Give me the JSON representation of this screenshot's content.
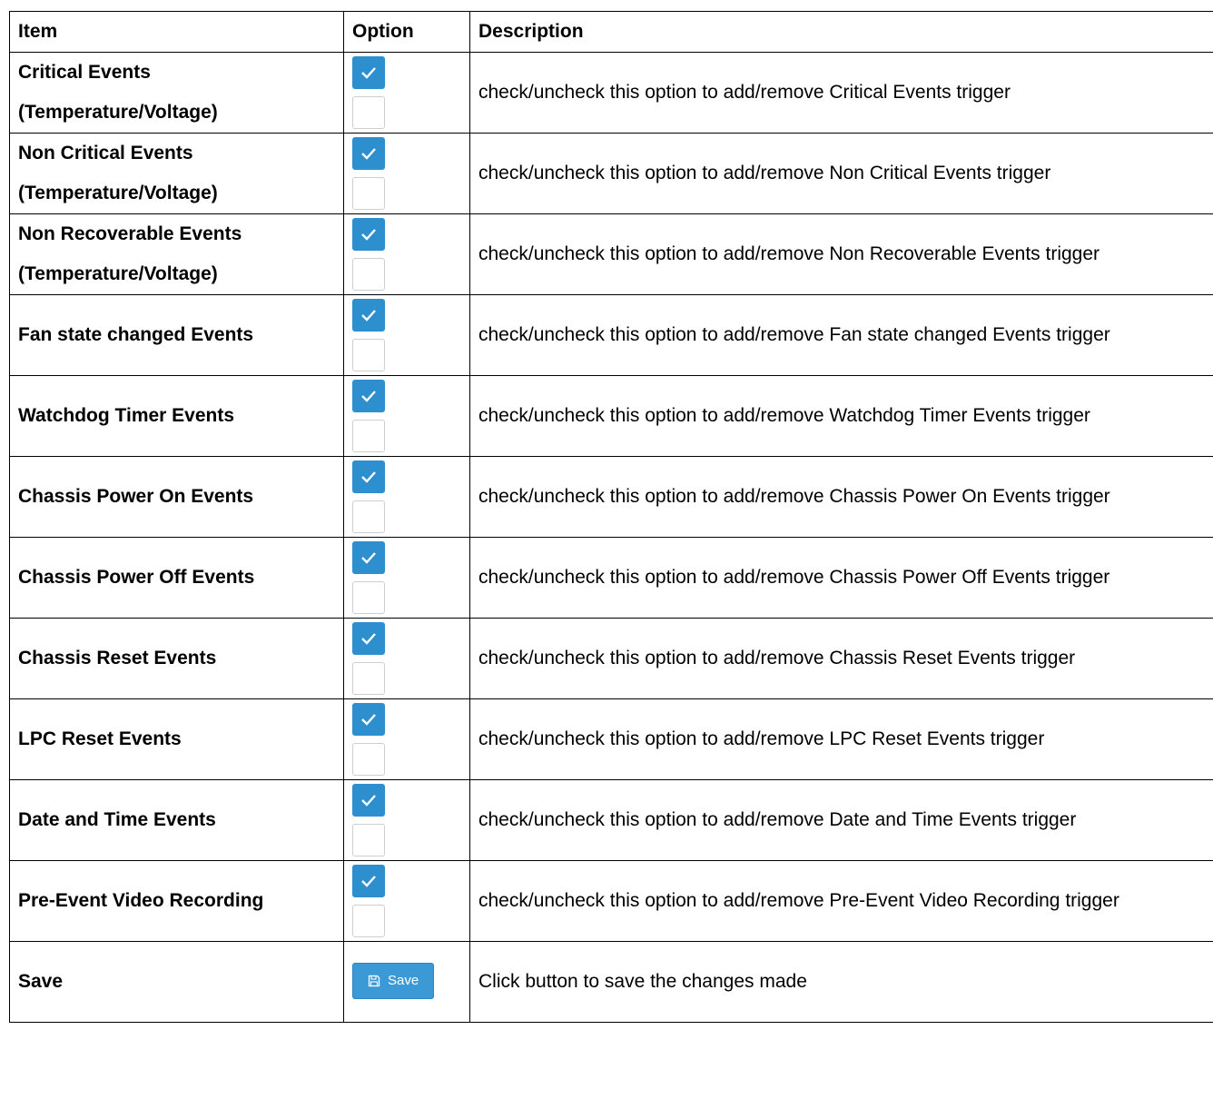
{
  "table": {
    "headers": {
      "item": "Item",
      "option": "Option",
      "description": "Description"
    },
    "rows": [
      {
        "item": "Critical Events (Temperature/Voltage)",
        "description": "check/uncheck this option to add/remove Critical Events trigger"
      },
      {
        "item": "Non Critical Events (Temperature/Voltage)",
        "description": "check/uncheck this option to add/remove Non Critical Events trigger"
      },
      {
        "item": "Non Recoverable Events (Temperature/Voltage)",
        "description": "check/uncheck this option to add/remove Non Recoverable Events trigger"
      },
      {
        "item": "Fan state changed Events",
        "description": "check/uncheck this option to add/remove Fan state changed Events trigger"
      },
      {
        "item": "Watchdog Timer Events",
        "description": "check/uncheck this option to add/remove Watchdog Timer Events trigger"
      },
      {
        "item": "Chassis Power On Events",
        "description": "check/uncheck this option to add/remove Chassis Power On Events trigger"
      },
      {
        "item": "Chassis Power Off Events",
        "description": "check/uncheck this option to add/remove Chassis Power Off Events trigger"
      },
      {
        "item": "Chassis Reset Events",
        "description": "check/uncheck this option to add/remove Chassis Reset Events trigger"
      },
      {
        "item": "LPC Reset Events",
        "description": "check/uncheck this option to add/remove LPC Reset Events trigger"
      },
      {
        "item": "Date and Time Events",
        "description": "check/uncheck this option to add/remove Date and Time Events trigger"
      },
      {
        "item": "Pre-Event Video Recording",
        "description": "check/uncheck this option to add/remove Pre-Event Video Recording trigger"
      }
    ],
    "save_row": {
      "item": "Save",
      "button_label": "Save",
      "button_icon": "floppy-disk-icon",
      "description": "Click button to save the changes made"
    }
  },
  "colors": {
    "checkbox_checked": "#2e8fcf",
    "checkbox_unchecked_border": "#cfcfcf",
    "save_button": "#3b9ad6"
  }
}
